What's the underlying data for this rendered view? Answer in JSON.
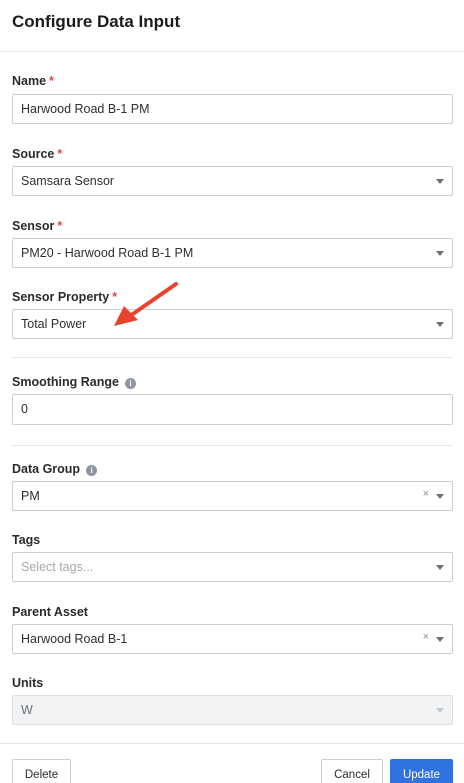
{
  "dialog": {
    "title": "Configure Data Input"
  },
  "fields": {
    "name": {
      "label": "Name",
      "required_mark": "*",
      "value": "Harwood Road B-1 PM"
    },
    "source": {
      "label": "Source",
      "required_mark": "*",
      "value": "Samsara Sensor"
    },
    "sensor": {
      "label": "Sensor",
      "required_mark": "*",
      "value": "PM20 - Harwood Road B-1 PM"
    },
    "sensor_property": {
      "label": "Sensor Property",
      "required_mark": "*",
      "value": "Total Power"
    },
    "smoothing_range": {
      "label": "Smoothing Range",
      "info": "i",
      "value": "0"
    },
    "data_group": {
      "label": "Data Group",
      "info": "i",
      "value": "PM",
      "clear": "×"
    },
    "tags": {
      "label": "Tags",
      "placeholder": "Select tags..."
    },
    "parent_asset": {
      "label": "Parent Asset",
      "value": "Harwood Road B-1",
      "clear": "×"
    },
    "units": {
      "label": "Units",
      "value": "W"
    }
  },
  "footer": {
    "delete_label": "Delete",
    "cancel_label": "Cancel",
    "update_label": "Update"
  },
  "colors": {
    "required": "#e0464b",
    "primary": "#2f72e0",
    "annotation_arrow": "#e8432e"
  },
  "icons": [
    "info-icon",
    "chevron-down-icon",
    "clear-icon",
    "annotation-arrow-icon"
  ]
}
